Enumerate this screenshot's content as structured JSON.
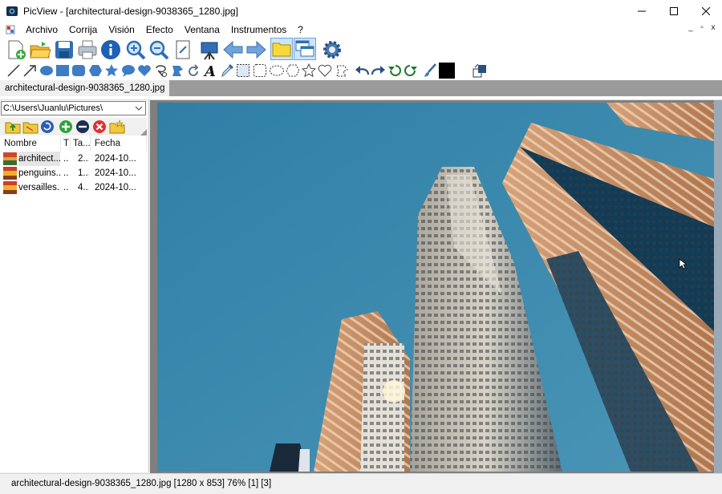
{
  "window": {
    "title": "PicView - [architectural-design-9038365_1280.jpg]",
    "controls": [
      "minimize",
      "maximize",
      "close"
    ]
  },
  "menubar": {
    "items": [
      "Archivo",
      "Corrija",
      "Visión",
      "Efecto",
      "Ventana",
      "Instrumentos",
      "?"
    ],
    "mdi_controls": [
      "_",
      "▫",
      "x"
    ]
  },
  "toolbar_main": {
    "icons": [
      "new-file-icon",
      "open-folder-icon",
      "save-icon",
      "print-icon",
      "info-icon",
      "zoom-in-icon",
      "zoom-out-icon",
      "fit-page-icon",
      "slideshow-icon",
      "previous-icon",
      "next-icon",
      "folder-panel-icon",
      "window-layout-icon",
      "settings-icon"
    ]
  },
  "toolbar_draw": {
    "icons": [
      "line-icon",
      "arrow-icon",
      "ellipse-icon",
      "rectangle-icon",
      "rounded-rect-icon",
      "hexagon-icon",
      "star-icon",
      "speech-bubble-icon",
      "heart-icon",
      "lasso-icon",
      "freeform-icon",
      "rotate-icon",
      "text-icon",
      "eyedropper-icon",
      "select-rect-icon",
      "select-rounded-icon",
      "select-ellipse-icon",
      "select-hexagon-icon",
      "select-star-icon",
      "select-heart-icon",
      "select-free-icon",
      "undo-icon",
      "redo-icon",
      "rotate-left-icon",
      "rotate-right-icon",
      "brush-icon",
      "foreground-color-icon",
      "background-color-icon",
      "swap-colors-icon"
    ],
    "foreground_color": "#000000",
    "background_color": "#ffffff"
  },
  "tabs": [
    {
      "label": "architectural-design-9038365_1280.jpg",
      "active": true
    }
  ],
  "browser": {
    "path": "C:\\Users\\Juanlu\\Pictures\\",
    "tool_icons": [
      "folder-up-icon",
      "folder-open-icon",
      "refresh-icon",
      "add-icon",
      "remove-icon",
      "delete-icon",
      "new-folder-icon"
    ],
    "columns": [
      "Nombre",
      "T",
      "Ta...",
      "Fecha"
    ],
    "files": [
      {
        "name": "architect...",
        "type": "..",
        "size": "2...",
        "date": "2024-10...",
        "selected": true
      },
      {
        "name": "penguins...",
        "type": "..",
        "size": "1...",
        "date": "2024-10...",
        "selected": false
      },
      {
        "name": "versailles...",
        "type": "..",
        "size": "4...",
        "date": "2024-10...",
        "selected": false
      }
    ]
  },
  "statusbar": {
    "text": "architectural-design-9038365_1280.jpg [1280 x 853] 76% [1] [3]"
  },
  "colors": {
    "sky": "#3b84a6",
    "viewer_bg": "#7f7f7f",
    "tabstrip": "#9b9b9b",
    "accent_blue": "#2f6fb3"
  }
}
